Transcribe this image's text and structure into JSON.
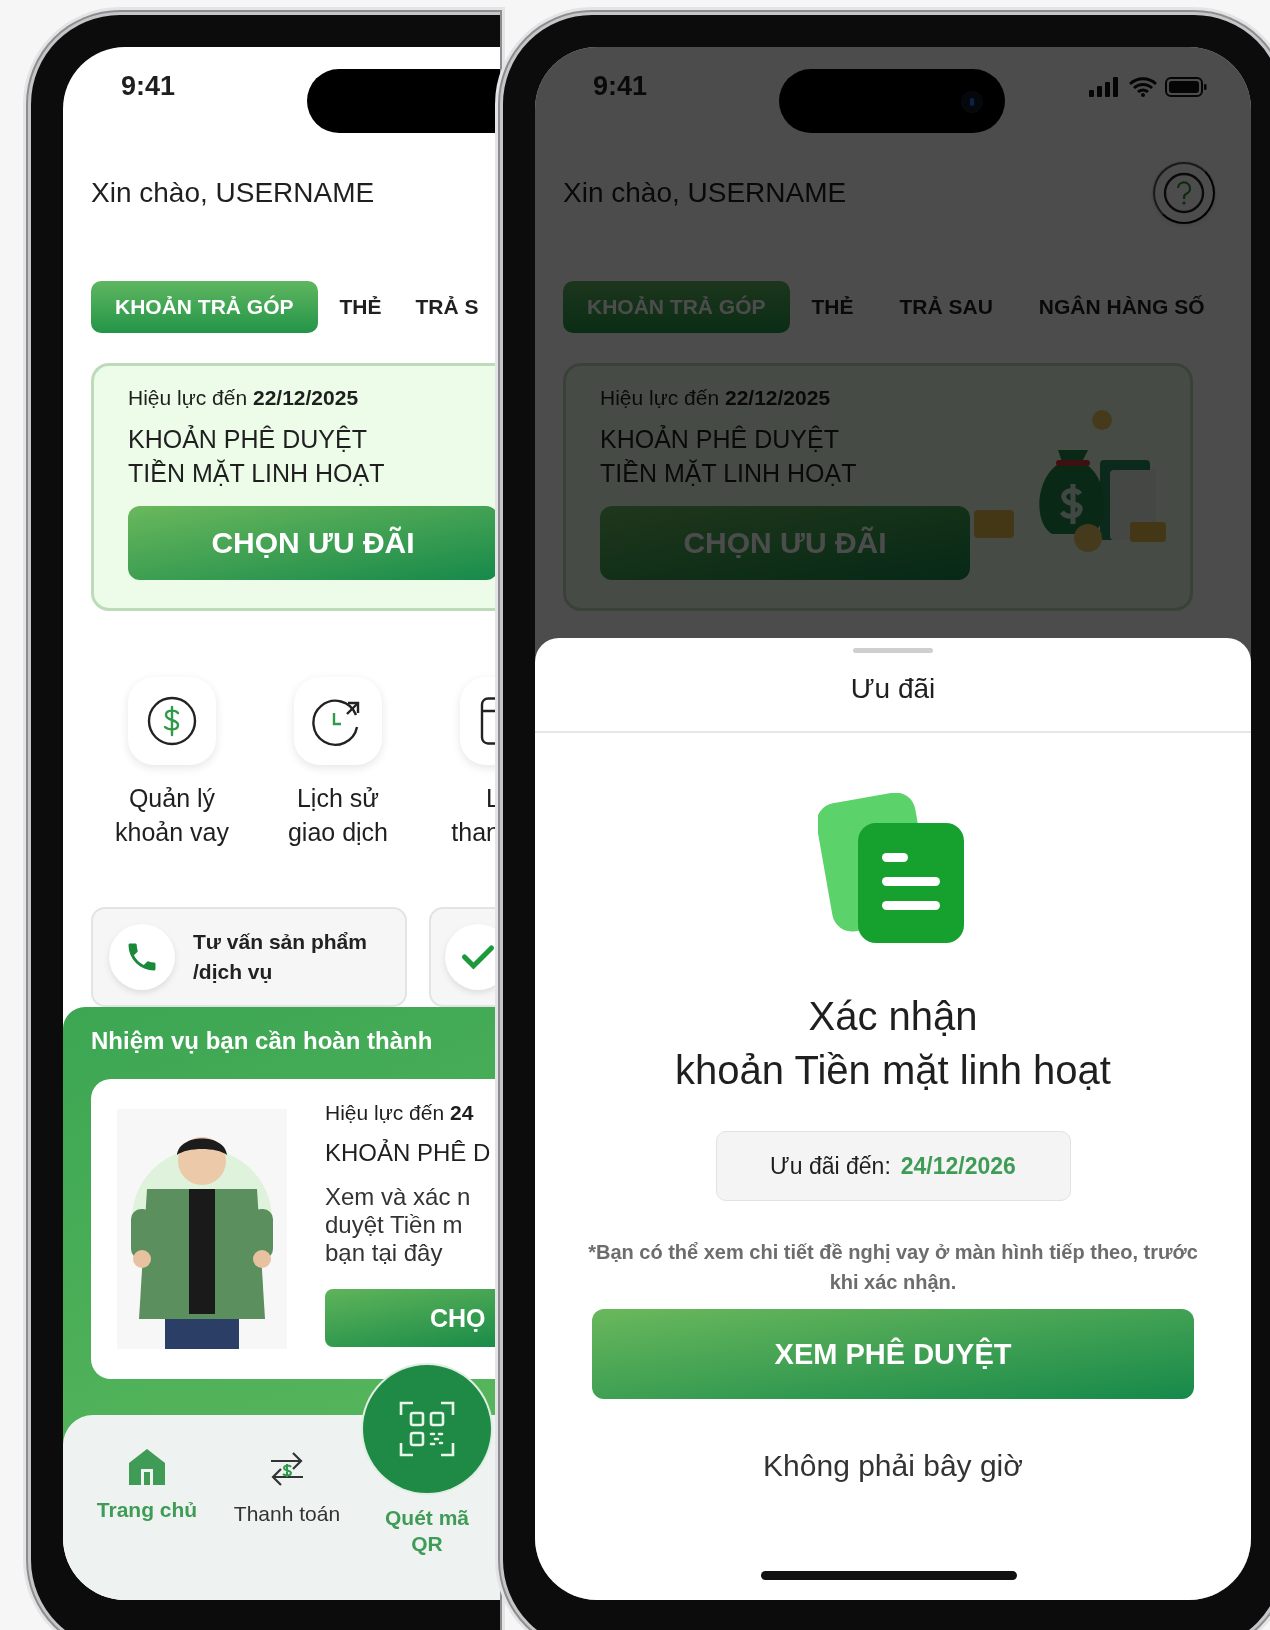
{
  "left_phone": {
    "status_time": "9:41",
    "greeting": "Xin chào, USERNAME",
    "tabs": [
      {
        "label": "KHOẢN TRẢ GÓP",
        "selected": true
      },
      {
        "label": "THẺ",
        "selected": false
      },
      {
        "label": "TRẢ S",
        "selected": false
      }
    ],
    "offer_card": {
      "validity_label": "Hiệu lực đến",
      "validity_date": "22/12/2025",
      "title_lines": [
        "KHOẢN PHÊ DUYỆT",
        "TIỀN MẶT LINH HOẠT"
      ],
      "button": "CHỌN ƯU ĐÃI"
    },
    "shortcuts": [
      {
        "kind": "dollar",
        "label": "Quản lý\nkhoản vay"
      },
      {
        "kind": "history",
        "label": "Lịch sử\ngiao dịch"
      },
      {
        "kind": "document",
        "label": "L\nthan"
      }
    ],
    "contact_buttons": [
      {
        "kind": "phone",
        "label": "Tư vấn sản phẩm\n/dịch vụ"
      },
      {
        "kind": "check"
      }
    ],
    "tasks": {
      "heading": "Nhiệm vụ bạn cần hoàn thành",
      "validity_label": "Hiệu lực đến",
      "validity_date": "24",
      "title": "KHOẢN PHÊ D",
      "description": "Xem và xác n\nduyệt Tiền m\nbạn tại đây",
      "button": "CHỌ"
    },
    "bottom_nav": [
      {
        "kind": "home",
        "label": "Trang chủ",
        "selected": true
      },
      {
        "kind": "transfer",
        "label": "Thanh toán",
        "selected": false
      },
      {
        "kind": "qr",
        "label": "Quét mã\nQR",
        "selected": false
      }
    ]
  },
  "right_phone": {
    "status_time": "9:41",
    "greeting": "Xin chào, USERNAME",
    "tabs": [
      {
        "label": "KHOẢN TRẢ GÓP",
        "selected": true
      },
      {
        "label": "THẺ",
        "selected": false
      },
      {
        "label": "TRẢ SAU",
        "selected": false
      },
      {
        "label": "NGÂN HÀNG SỐ",
        "selected": false
      }
    ],
    "offer_card": {
      "validity_label": "Hiệu lực đến",
      "validity_date": "22/12/2025",
      "title_lines": [
        "KHOẢN PHÊ DUYỆT",
        "TIỀN MẶT LINH HOẠT"
      ],
      "button": "CHỌN ƯU ĐÃI"
    },
    "sheet": {
      "title": "Ưu đãi",
      "heading_lines": [
        "Xác nhận",
        "khoản Tiền mặt linh hoạt"
      ],
      "offer_label": "Ưu đãi đến:",
      "offer_date": "24/12/2026",
      "note": "*Bạn có thể xem chi tiết đề nghị vay ở màn hình tiếp theo, trước khi xác nhận.",
      "primary_button": "XEM PHÊ DUYỆT",
      "secondary_button": "Không phải bây giờ"
    }
  }
}
